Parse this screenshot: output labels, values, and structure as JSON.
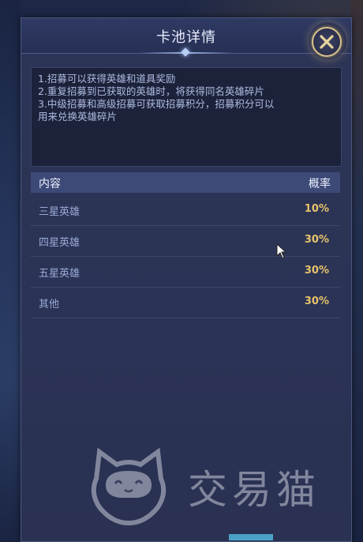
{
  "dialog": {
    "title": "卡池详情",
    "close_icon": "close-icon"
  },
  "description": {
    "lines": [
      "1.招募可以获得英雄和道具奖励",
      "2.重复招募到已获取的英雄时，将获得同名英雄碎片",
      "3.中级招募和高级招募可获取招募积分，招募积分可以",
      "用来兑换英雄碎片"
    ]
  },
  "table": {
    "header_content": "内容",
    "header_probability": "概率",
    "rows": [
      {
        "label": "三星英雄",
        "value": "10%"
      },
      {
        "label": "四星英雄",
        "value": "30%"
      },
      {
        "label": "五星英雄",
        "value": "30%"
      },
      {
        "label": "其他",
        "value": "30%"
      }
    ]
  },
  "watermark": {
    "text": "交易猫"
  },
  "colors": {
    "accent_gold": "#e8c46a",
    "panel_bg": "#2d3557",
    "header_bar": "#3d4977"
  }
}
